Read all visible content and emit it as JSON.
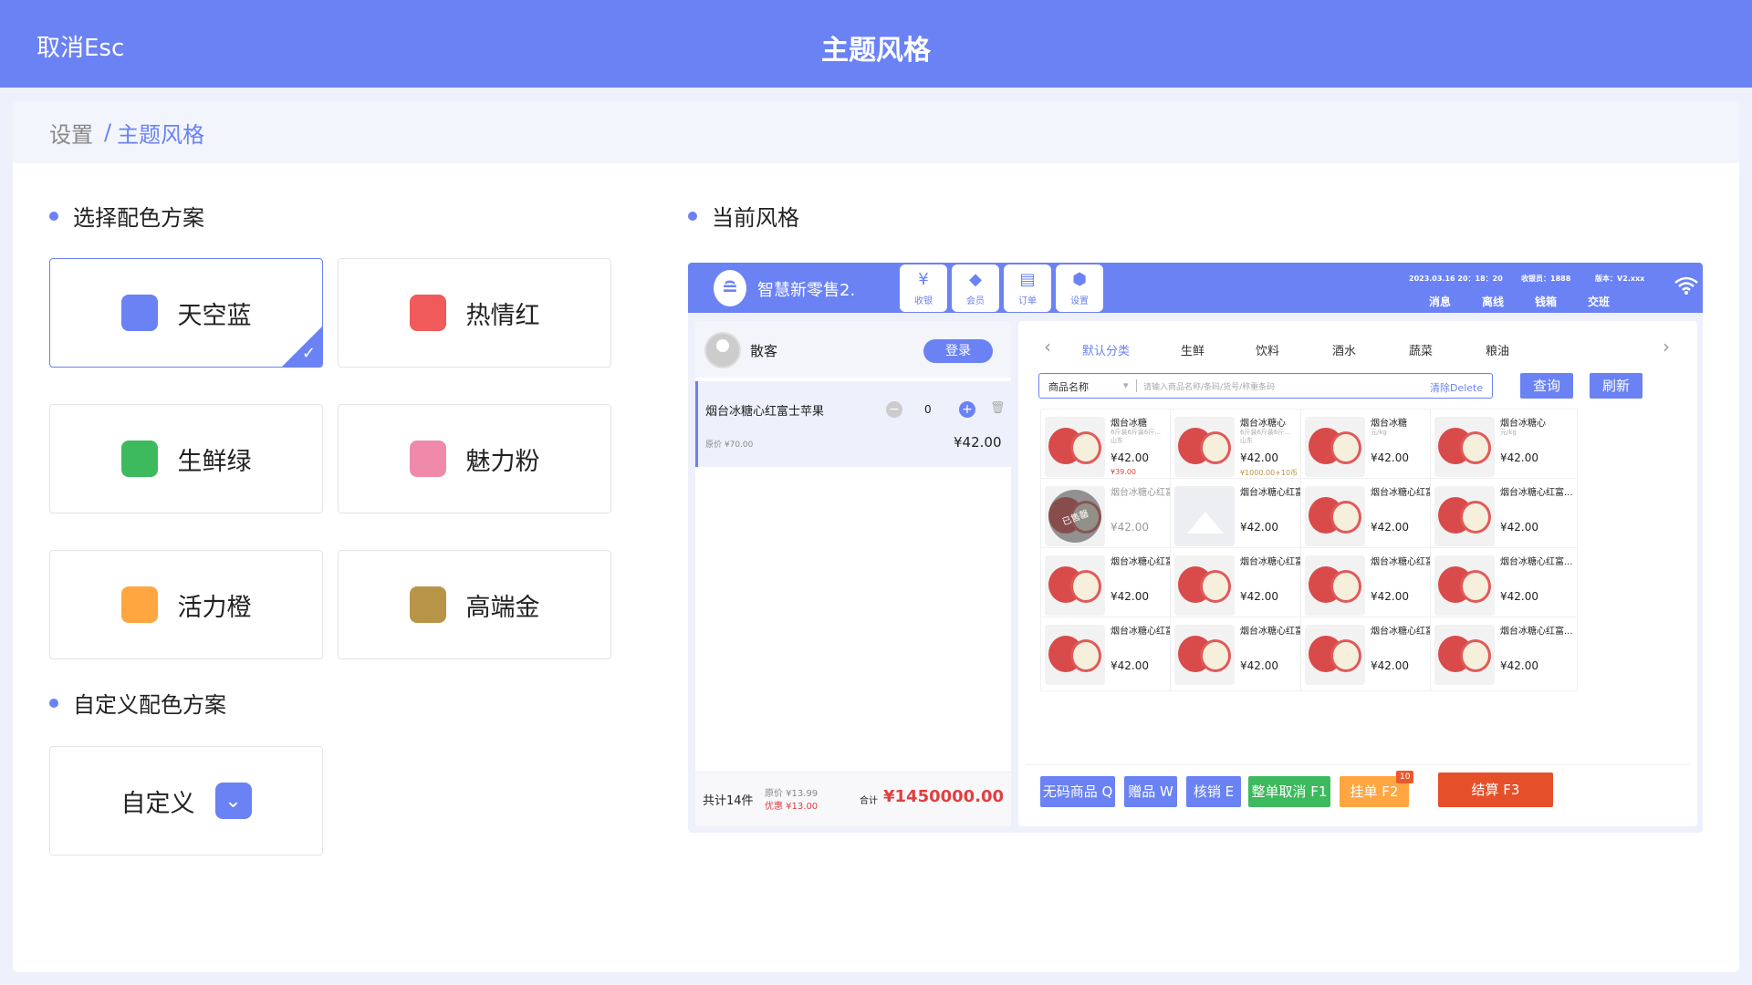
{
  "topbar": {
    "cancel": "取消Esc",
    "title": "主题风格"
  },
  "breadcrumb": {
    "root": "设置",
    "sep": "/",
    "current": "主题风格"
  },
  "sections": {
    "choose": "选择配色方案",
    "current": "当前风格",
    "custom": "自定义配色方案"
  },
  "themes": [
    {
      "label": "天空蓝",
      "color": "#6a82f4",
      "selected": true
    },
    {
      "label": "热情红",
      "color": "#f05a5a"
    },
    {
      "label": "生鲜绿",
      "color": "#3dba5e"
    },
    {
      "label": "魅力粉",
      "color": "#f08aab"
    },
    {
      "label": "活力橙",
      "color": "#ffa640"
    },
    {
      "label": "高端金",
      "color": "#b89448"
    }
  ],
  "custom": {
    "label": "自定义"
  },
  "preview": {
    "brand": "智慧新零售2.",
    "nav": [
      {
        "icon": "¥",
        "label": "收银"
      },
      {
        "icon": "◆",
        "label": "会员"
      },
      {
        "icon": "▤",
        "label": "订单"
      },
      {
        "icon": "⬢",
        "label": "设置"
      }
    ],
    "info": {
      "datetime": "2023.03.16 20：18：20",
      "cashier": "收银员：1888",
      "version": "版本：V2.xxx"
    },
    "links": [
      "消息",
      "离线",
      "钱箱",
      "交班"
    ],
    "guest": "散客",
    "login": "登录",
    "cart": {
      "name": "烟台冰糖心红富士苹果",
      "orig": "原价 ¥70.00",
      "qty": "0",
      "price": "¥42.00"
    },
    "summary": {
      "count": "共计14件",
      "orig": "原价 ¥13.99",
      "disc": "优惠 ¥13.00",
      "total_label": "合计",
      "total": "¥1450000.00"
    },
    "tabs": [
      "默认分类",
      "生鲜",
      "饮料",
      "酒水",
      "蔬菜",
      "粮油"
    ],
    "search": {
      "select": "商品名称",
      "placeholder": "请输入商品名称/条码/货号/称重条码",
      "clear": "清除Delete"
    },
    "btn_query": "查询",
    "btn_refresh": "刷新",
    "items": [
      {
        "name": "烟台冰糖",
        "spec": "6斤装6斤装6斤...",
        "spec2": "山东",
        "price": "¥42.00",
        "sub": "¥39.00",
        "sub_type": "red"
      },
      {
        "name": "烟台冰糖心",
        "spec": "6斤装6斤装6斤...",
        "spec2": "山东",
        "price": "¥42.00",
        "sub": "¥1000.00+10币",
        "sub_type": "gold"
      },
      {
        "name": "烟台冰糖",
        "spec": "元/kg",
        "price": "¥42.00"
      },
      {
        "name": "烟台冰糖心",
        "spec": "元/kg",
        "price": "¥42.00"
      },
      {
        "name": "烟台冰糖心红富...",
        "price": "¥42.00",
        "state": "soldout",
        "sold": "已售罄"
      },
      {
        "name": "烟台冰糖心红富...",
        "price": "¥42.00",
        "state": "noimage"
      },
      {
        "name": "烟台冰糖心红富...",
        "price": "¥42.00"
      },
      {
        "name": "烟台冰糖心红富...",
        "price": "¥42.00"
      },
      {
        "name": "烟台冰糖心红富...",
        "price": "¥42.00"
      },
      {
        "name": "烟台冰糖心红富...",
        "price": "¥42.00"
      },
      {
        "name": "烟台冰糖心红富...",
        "price": "¥42.00"
      },
      {
        "name": "烟台冰糖心红富...",
        "price": "¥42.00"
      },
      {
        "name": "烟台冰糖心红富...",
        "price": "¥42.00"
      },
      {
        "name": "烟台冰糖心红富...",
        "price": "¥42.00"
      },
      {
        "name": "烟台冰糖心红富...",
        "price": "¥42.00"
      },
      {
        "name": "烟台冰糖心红富...",
        "price": "¥42.00"
      }
    ],
    "footer": [
      {
        "label": "无码商品 Q",
        "color": "#6a82f4"
      },
      {
        "label": "赠品 W",
        "color": "#6a82f4"
      },
      {
        "label": "核销 E",
        "color": "#6a82f4"
      },
      {
        "label": "整单取消 F1",
        "color": "#3dba5e"
      },
      {
        "label": "挂单 F2",
        "color": "#ffa640",
        "badge": "10"
      },
      {
        "label": "结算 F3",
        "color": "#e5502a"
      }
    ]
  }
}
